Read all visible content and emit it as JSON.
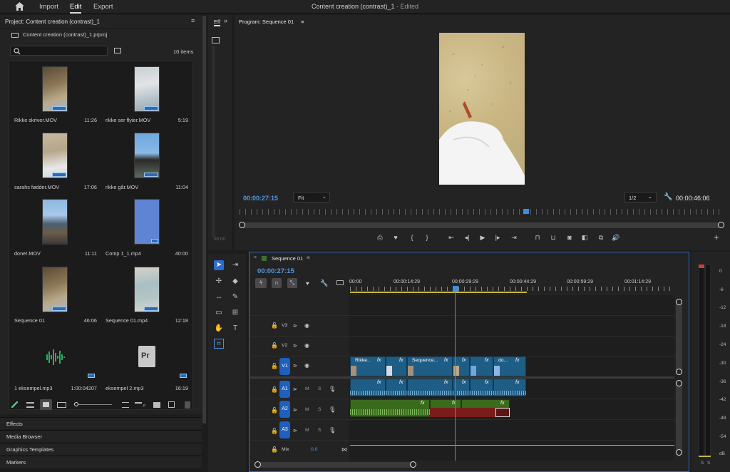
{
  "topbar": {
    "home_icon": "home-icon",
    "import": "Import",
    "edit": "Edit",
    "export": "Export",
    "doc_title": "Content creation (contrast)_1",
    "doc_suffix": " - Edited"
  },
  "project": {
    "title": "Project: Content creation (contrast)_1",
    "file": "Content creation (contrast)_1.prproj",
    "search_placeholder": "",
    "items_count": "10 items",
    "items": [
      {
        "name": "Rikke skriver.MOV",
        "duration": "11:26"
      },
      {
        "name": "rikke ser flyier.MOV",
        "duration": "5:19"
      },
      {
        "name": "sarahs fødder.MOV",
        "duration": "17:06"
      },
      {
        "name": "rikke går.MOV",
        "duration": "11:04"
      },
      {
        "name": "done!.MOV",
        "duration": "11:11"
      },
      {
        "name": "Comp 1_1.mp4",
        "duration": "40:00"
      },
      {
        "name": "Sequence 01",
        "duration": "46:06"
      },
      {
        "name": "Sequence 01.mp4",
        "duration": "12:18"
      },
      {
        "name": "1 eksempel.mp3",
        "duration": "1:00:04207"
      },
      {
        "name": "eksempel 2.mp3",
        "duration": "16:19"
      }
    ]
  },
  "bottom_tabs": {
    "effects": "Effects",
    "media_browser": "Media Browser",
    "graphics_templates": "Graphics Templates",
    "markers": "Markers"
  },
  "effects_panel": {
    "tab": "Eff",
    "overflow": "»",
    "timecode": "00:00"
  },
  "program": {
    "title": "Program: Sequence 01",
    "timecode": "00:00:27:15",
    "fit": "Fit",
    "resolution": "1/2",
    "duration": "00:00:46:06"
  },
  "sequence": {
    "tab": "Sequence 01",
    "timecode": "00:00:27:15",
    "ruler": [
      "00:00",
      "00:00:14:29",
      "00:00:29:29",
      "00:00:44:29",
      "00:00:59:29",
      "00:01:14:29"
    ],
    "tracks": {
      "v3": "V3",
      "v2": "V2",
      "v1": "V1",
      "a1": "A1",
      "a2": "A2",
      "a3": "A3",
      "mix": "Mix",
      "mix_value": "0,0",
      "m": "M",
      "s": "S"
    },
    "clips": {
      "c1": "Rikke...",
      "c2": "Sequence...",
      "c3": "do...",
      "fx": "fx"
    }
  },
  "meter": {
    "labels": [
      "0",
      "-6",
      "-12",
      "-18",
      "-24",
      "-30",
      "-36",
      "-42",
      "-48",
      "-54",
      "dB"
    ],
    "solo": "S"
  },
  "colors": {
    "accent": "#2d8ceb",
    "video_clip": "#1e5d86",
    "audio_green": "#3a6b1c",
    "audio_red": "#7b1c1c",
    "playhead": "#3a8ee6"
  }
}
